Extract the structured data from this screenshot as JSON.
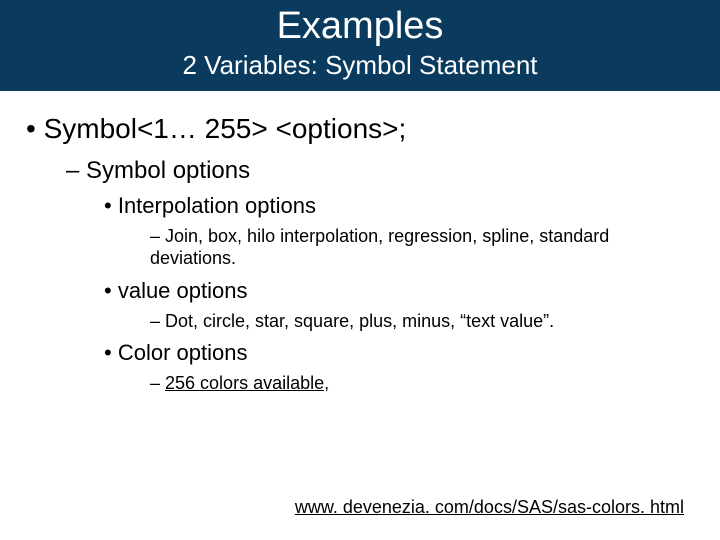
{
  "header": {
    "title": "Examples",
    "subtitle": "2 Variables: Symbol Statement"
  },
  "content": {
    "syntax": "Symbol<1… 255> <options>;",
    "symbol_options_label": "Symbol options",
    "interpolation": {
      "label": "Interpolation options",
      "detail": "Join, box, hilo interpolation, regression, spline, standard deviations."
    },
    "value": {
      "label": "value options",
      "detail": "Dot, circle, star, square, plus, minus, “text value”."
    },
    "color": {
      "label": "Color options",
      "detail": "256 colors available,"
    }
  },
  "footer": {
    "link": "www. devenezia. com/docs/SAS/sas-colors. html"
  }
}
